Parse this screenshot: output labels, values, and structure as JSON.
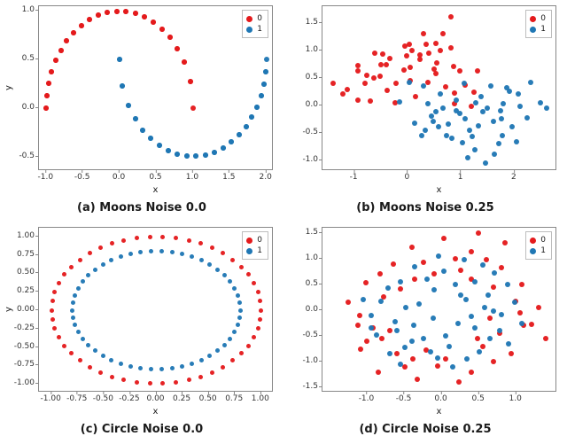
{
  "colors": {
    "class0": "#e41a1c",
    "class1": "#1f77b4",
    "axis": "#888888"
  },
  "legend_labels": {
    "c0": "0",
    "c1": "1"
  },
  "axis_labels": {
    "x": "x",
    "y": "y"
  },
  "captions": {
    "a": "(a) Moons Noise 0.0",
    "b": "(b) Moons Noise 0.25",
    "c": "(c) Circle Noise 0.0",
    "d": "(d) Circle Noise 0.25"
  },
  "chart_data": [
    {
      "id": "a",
      "type": "scatter",
      "title": "",
      "xlabel": "x",
      "ylabel": "y",
      "xlim": [
        -1.1,
        2.1
      ],
      "ylim": [
        -0.65,
        1.05
      ],
      "xticks": [
        -1.0,
        -0.5,
        0.0,
        0.5,
        1.0,
        1.5,
        2.0
      ],
      "yticks": [
        -0.5,
        0.0,
        0.5,
        1.0
      ],
      "legend": [
        "0",
        "1"
      ],
      "series": [
        {
          "name": "0",
          "color": "class0",
          "x": [
            -1.0,
            -0.992,
            -0.967,
            -0.927,
            -0.872,
            -0.803,
            -0.721,
            -0.627,
            -0.524,
            -0.412,
            -0.293,
            -0.169,
            -0.042,
            0.086,
            0.213,
            0.339,
            0.461,
            0.578,
            0.688,
            0.789,
            0.881,
            0.962,
            1.0,
            0.962,
            0.881,
            0.789,
            0.688,
            0.578,
            0.461,
            0.339,
            0.213,
            0.086,
            -0.042,
            -0.169,
            -0.293,
            -0.412,
            -0.524,
            -0.627,
            -0.721,
            -0.803,
            -0.872,
            -0.927,
            -0.967,
            -0.992,
            -1.0
          ],
          "y": [
            0.0,
            0.128,
            0.254,
            0.375,
            0.49,
            0.596,
            0.693,
            0.779,
            0.852,
            0.911,
            0.956,
            0.986,
            0.999,
            0.996,
            0.977,
            0.941,
            0.888,
            0.816,
            0.726,
            0.614,
            0.472,
            0.275,
            0.0,
            0.275,
            0.472,
            0.614,
            0.726,
            0.816,
            0.888,
            0.941,
            0.977,
            0.996,
            0.999,
            0.986,
            0.956,
            0.911,
            0.852,
            0.779,
            0.693,
            0.596,
            0.49,
            0.375,
            0.254,
            0.128,
            0.0
          ]
        },
        {
          "name": "1",
          "color": "class1",
          "x": [
            0.0,
            0.038,
            0.119,
            0.211,
            0.312,
            0.422,
            0.539,
            0.661,
            0.787,
            0.914,
            1.042,
            1.169,
            1.293,
            1.412,
            1.524,
            1.627,
            1.721,
            1.803,
            1.872,
            1.927,
            1.967,
            1.992,
            2.0,
            1.992,
            1.967,
            1.927,
            1.872,
            1.803,
            1.721,
            1.627,
            1.524,
            1.412,
            1.293,
            1.169,
            1.042,
            0.914,
            0.787,
            0.661,
            0.539,
            0.422,
            0.312,
            0.211,
            0.119,
            0.038,
            0.0
          ],
          "y": [
            0.5,
            0.225,
            0.028,
            -0.114,
            -0.226,
            -0.316,
            -0.388,
            -0.441,
            -0.477,
            -0.496,
            -0.499,
            -0.486,
            -0.456,
            -0.411,
            -0.352,
            -0.279,
            -0.193,
            -0.096,
            0.01,
            0.125,
            0.246,
            0.372,
            0.5,
            0.372,
            0.246,
            0.125,
            0.01,
            -0.096,
            -0.193,
            -0.279,
            -0.352,
            -0.411,
            -0.456,
            -0.486,
            -0.499,
            -0.496,
            -0.477,
            -0.441,
            -0.388,
            -0.316,
            -0.226,
            -0.114,
            0.028,
            0.225,
            0.5
          ]
        }
      ]
    },
    {
      "id": "b",
      "type": "scatter",
      "title": "",
      "xlabel": "x",
      "ylabel": "",
      "xlim": [
        -1.6,
        2.8
      ],
      "ylim": [
        -1.2,
        1.8
      ],
      "xticks": [
        -1,
        0,
        1,
        2
      ],
      "yticks": [
        -1.0,
        -0.5,
        0.0,
        0.5,
        1.0,
        1.5
      ],
      "legend": [
        "0",
        "1"
      ],
      "series": [
        {
          "name": "0",
          "color": "class0",
          "x": [
            -1.22,
            -0.94,
            -0.77,
            -0.52,
            -0.93,
            -0.63,
            -0.41,
            -0.47,
            -0.08,
            -0.33,
            -0.02,
            -0.05,
            0.03,
            0.22,
            0.05,
            0.4,
            0.3,
            0.52,
            0.6,
            0.49,
            0.81,
            0.85,
            1.08,
            0.88,
            0.88,
            1.19,
            0.66,
            1.3,
            -0.23,
            0.97,
            -0.62,
            -1.14,
            0.52,
            0.37,
            0.04,
            0.8,
            1.24,
            -0.38,
            0.23,
            -0.7,
            0.54,
            0.15,
            -0.24,
            -0.8,
            -0.51,
            0.34,
            0.71,
            -0.94,
            0.08,
            -1.4
          ],
          "y": [
            0.21,
            0.09,
            0.55,
            0.53,
            0.63,
            0.49,
            0.73,
            0.93,
            0.64,
            0.85,
            0.9,
            1.08,
            1.11,
            0.83,
            0.68,
            0.95,
            1.3,
            1.12,
            1.0,
            0.66,
            1.6,
            0.71,
            0.37,
            0.22,
            0.03,
            -0.02,
            1.3,
            0.62,
            0.4,
            0.62,
            0.95,
            0.28,
            0.57,
            0.42,
            0.45,
            1.05,
            0.23,
            0.27,
            0.91,
            0.08,
            0.77,
            0.15,
            0.05,
            0.4,
            0.74,
            1.1,
            0.34,
            0.72,
            0.99,
            0.4
          ]
        },
        {
          "name": "1",
          "color": "class1",
          "x": [
            0.02,
            0.3,
            -0.16,
            0.37,
            0.53,
            0.47,
            0.33,
            0.65,
            0.76,
            0.72,
            0.91,
            1.16,
            1.03,
            1.32,
            1.4,
            1.21,
            1.48,
            1.26,
            1.61,
            1.77,
            1.79,
            1.62,
            1.96,
            1.74,
            2.03,
            2.07,
            1.85,
            2.23,
            2.49,
            2.3,
            1.08,
            0.91,
            1.55,
            0.44,
            1.7,
            1.12,
            0.82,
            2.1,
            0.6,
            1.38,
            0.12,
            0.98,
            1.27,
            1.9,
            0.26,
            1.45,
            2.6,
            1.06,
            0.58,
            1.75
          ],
          "y": [
            0.42,
            0.35,
            0.06,
            0.02,
            -0.12,
            -0.3,
            -0.45,
            -0.05,
            -0.34,
            -0.55,
            -0.1,
            -0.45,
            -0.68,
            -0.38,
            -0.12,
            -0.57,
            -0.06,
            -0.82,
            -0.3,
            -0.55,
            0.02,
            -0.9,
            -0.4,
            -0.11,
            -0.66,
            0.2,
            0.31,
            -0.23,
            0.05,
            0.42,
            -0.25,
            0.09,
            0.35,
            -0.2,
            -0.7,
            -0.95,
            -0.6,
            -0.02,
            0.2,
            0.15,
            -0.33,
            -0.15,
            0.05,
            0.25,
            -0.55,
            -1.05,
            -0.05,
            0.4,
            -0.4,
            -0.25
          ]
        }
      ]
    },
    {
      "id": "c",
      "type": "scatter",
      "title": "",
      "xlabel": "x",
      "ylabel": "y",
      "xlim": [
        -1.12,
        1.12
      ],
      "ylim": [
        -1.12,
        1.12
      ],
      "xticks": [
        -1.0,
        -0.75,
        -0.5,
        -0.25,
        0.0,
        0.25,
        0.5,
        0.75,
        1.0
      ],
      "yticks": [
        -1.0,
        -0.75,
        -0.5,
        -0.25,
        0.0,
        0.25,
        0.5,
        0.75,
        1.0
      ],
      "legend": [
        "0",
        "1"
      ],
      "series": [
        {
          "name": "0",
          "color": "class0",
          "x": [
            1.0,
            0.992,
            0.969,
            0.93,
            0.876,
            0.809,
            0.729,
            0.637,
            0.536,
            0.426,
            0.309,
            0.187,
            0.063,
            -0.063,
            -0.187,
            -0.309,
            -0.426,
            -0.536,
            -0.637,
            -0.729,
            -0.809,
            -0.876,
            -0.93,
            -0.969,
            -0.992,
            -1.0,
            -0.992,
            -0.969,
            -0.93,
            -0.876,
            -0.809,
            -0.729,
            -0.637,
            -0.536,
            -0.426,
            -0.309,
            -0.187,
            -0.063,
            0.063,
            0.187,
            0.309,
            0.426,
            0.536,
            0.637,
            0.729,
            0.809,
            0.876,
            0.93,
            0.969,
            0.992
          ],
          "y": [
            0.0,
            0.125,
            0.249,
            0.368,
            0.482,
            0.588,
            0.685,
            0.771,
            0.844,
            0.905,
            0.951,
            0.982,
            0.998,
            0.998,
            0.982,
            0.951,
            0.905,
            0.844,
            0.771,
            0.685,
            0.588,
            0.482,
            0.368,
            0.249,
            0.125,
            0.0,
            -0.125,
            -0.249,
            -0.368,
            -0.482,
            -0.588,
            -0.685,
            -0.771,
            -0.844,
            -0.905,
            -0.951,
            -0.982,
            -0.998,
            -0.998,
            -0.982,
            -0.951,
            -0.905,
            -0.844,
            -0.771,
            -0.685,
            -0.588,
            -0.482,
            -0.368,
            -0.249,
            -0.125
          ]
        },
        {
          "name": "1",
          "color": "class1",
          "x": [
            0.8,
            0.794,
            0.775,
            0.744,
            0.701,
            0.647,
            0.583,
            0.51,
            0.429,
            0.341,
            0.247,
            0.15,
            0.05,
            -0.05,
            -0.15,
            -0.247,
            -0.341,
            -0.429,
            -0.51,
            -0.583,
            -0.647,
            -0.701,
            -0.744,
            -0.775,
            -0.794,
            -0.8,
            -0.794,
            -0.775,
            -0.744,
            -0.701,
            -0.647,
            -0.583,
            -0.51,
            -0.429,
            -0.341,
            -0.247,
            -0.15,
            -0.05,
            0.05,
            0.15,
            0.247,
            0.341,
            0.429,
            0.51,
            0.583,
            0.647,
            0.701,
            0.744,
            0.775,
            0.794
          ],
          "y": [
            0.0,
            0.1,
            0.199,
            0.295,
            0.386,
            0.47,
            0.548,
            0.617,
            0.675,
            0.724,
            0.761,
            0.786,
            0.798,
            0.798,
            0.786,
            0.761,
            0.724,
            0.675,
            0.617,
            0.548,
            0.47,
            0.386,
            0.295,
            0.199,
            0.1,
            0.0,
            -0.1,
            -0.199,
            -0.295,
            -0.386,
            -0.47,
            -0.548,
            -0.617,
            -0.675,
            -0.724,
            -0.761,
            -0.786,
            -0.798,
            -0.798,
            -0.786,
            -0.761,
            -0.724,
            -0.675,
            -0.617,
            -0.548,
            -0.47,
            -0.386,
            -0.295,
            -0.199,
            -0.1
          ]
        }
      ]
    },
    {
      "id": "d",
      "type": "scatter",
      "title": "",
      "xlabel": "x",
      "ylabel": "",
      "xlim": [
        -1.6,
        1.55
      ],
      "ylim": [
        -1.6,
        1.6
      ],
      "xticks": [
        -1.0,
        -0.5,
        0.0,
        0.5,
        1.0
      ],
      "yticks": [
        -1.5,
        -1.0,
        -0.5,
        0.0,
        0.5,
        1.0,
        1.5
      ],
      "legend": [
        "0",
        "1"
      ],
      "series": [
        {
          "name": "0",
          "color": "class0",
          "x": [
            0.99,
            1.2,
            0.69,
            1.07,
            0.8,
            0.6,
            0.4,
            0.85,
            0.25,
            0.49,
            0.4,
            0.03,
            0.18,
            -0.25,
            -0.4,
            -0.1,
            -0.36,
            -0.65,
            -0.83,
            -0.55,
            -1.02,
            -1.25,
            -0.78,
            -1.1,
            -0.92,
            -1.0,
            -0.8,
            -1.12,
            -0.6,
            -1.09,
            -0.5,
            -0.85,
            -0.39,
            -0.7,
            -0.33,
            -0.05,
            -0.21,
            0.23,
            0.05,
            0.4,
            0.55,
            0.7,
            0.48,
            0.93,
            1.1,
            0.78,
            1.05,
            1.3,
            1.4,
            0.65
          ],
          "y": [
            0.18,
            -0.27,
            0.45,
            0.5,
            0.82,
            0.98,
            1.13,
            1.3,
            0.78,
            1.5,
            0.6,
            1.4,
            1.0,
            0.93,
            1.22,
            0.7,
            0.6,
            0.9,
            0.7,
            0.42,
            0.53,
            0.15,
            0.25,
            -0.1,
            -0.35,
            -0.6,
            -0.55,
            -0.3,
            -0.85,
            -0.75,
            -1.1,
            -1.2,
            -0.95,
            -0.4,
            -1.35,
            -1.08,
            -0.78,
            -1.4,
            -0.95,
            -1.2,
            -0.7,
            -1.0,
            -0.55,
            -0.85,
            -0.3,
            -0.45,
            -0.05,
            0.05,
            -0.55,
            -0.15
          ]
        },
        {
          "name": "1",
          "color": "class1",
          "x": [
            0.8,
            0.62,
            0.98,
            0.45,
            0.71,
            0.18,
            0.55,
            0.3,
            0.03,
            0.25,
            -0.04,
            -0.2,
            -0.36,
            -0.1,
            -0.55,
            -0.3,
            -0.72,
            -0.48,
            -0.82,
            -0.63,
            -0.95,
            -0.88,
            -0.6,
            -1.05,
            -0.5,
            -0.7,
            -0.25,
            -0.55,
            -0.05,
            -0.38,
            0.1,
            -0.12,
            0.34,
            0.05,
            0.5,
            0.22,
            0.65,
            0.4,
            0.78,
            0.58,
            0.88,
            1.08,
            0.32,
            -0.4,
            0.15,
            0.7,
            -0.15,
            0.9,
            -0.95,
            0.45
          ],
          "y": [
            -0.08,
            0.3,
            0.15,
            0.55,
            0.72,
            0.5,
            0.88,
            0.98,
            0.75,
            0.3,
            1.05,
            0.6,
            0.85,
            0.4,
            0.55,
            0.12,
            0.43,
            0.05,
            0.18,
            -0.22,
            -0.1,
            -0.48,
            -0.4,
            0.2,
            -0.72,
            -0.85,
            -0.55,
            -1.05,
            -0.93,
            -0.3,
            -0.7,
            -0.15,
            -0.95,
            -0.5,
            -0.8,
            -0.25,
            -0.55,
            -0.12,
            -0.4,
            0.05,
            0.5,
            -0.25,
            0.2,
            -0.6,
            -1.1,
            -0.02,
            -0.8,
            -0.65,
            -0.35,
            -0.35
          ]
        }
      ]
    }
  ]
}
